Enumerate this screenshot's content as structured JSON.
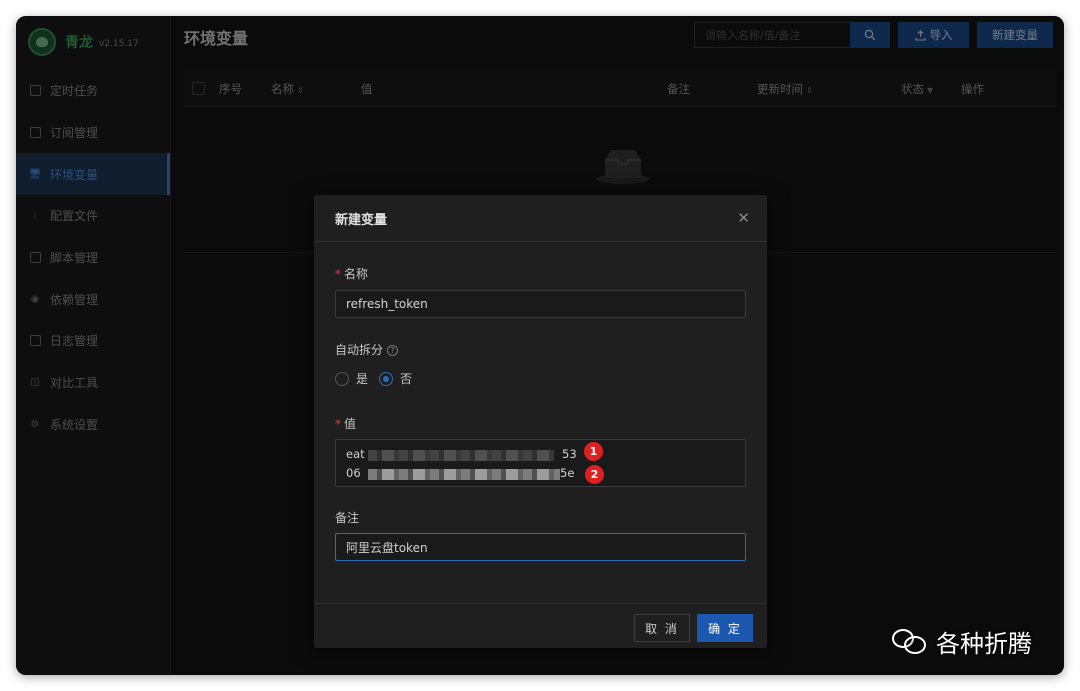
{
  "app": {
    "name": "青龙",
    "version": "v2.15.17"
  },
  "sidebar": {
    "items": [
      {
        "label": "定时任务",
        "icon": "calendar-icon",
        "active": false
      },
      {
        "label": "订阅管理",
        "icon": "subscription-icon",
        "active": false
      },
      {
        "label": "环境变量",
        "icon": "desktop-icon",
        "active": true
      },
      {
        "label": "配置文件",
        "icon": "control-icon",
        "active": false
      },
      {
        "label": "脚本管理",
        "icon": "script-icon",
        "active": false
      },
      {
        "label": "依赖管理",
        "icon": "database-icon",
        "active": false
      },
      {
        "label": "日志管理",
        "icon": "file-search-icon",
        "active": false
      },
      {
        "label": "对比工具",
        "icon": "diff-icon",
        "active": false
      },
      {
        "label": "系统设置",
        "icon": "setting-icon",
        "active": false
      }
    ]
  },
  "header": {
    "title": "环境变量",
    "search_placeholder": "请输入名称/值/备注",
    "import_label": "导入",
    "new_label": "新建变量"
  },
  "table": {
    "columns": [
      "序号",
      "名称",
      "值",
      "备注",
      "更新时间",
      "状态",
      "操作"
    ]
  },
  "modal": {
    "title": "新建变量",
    "name_label": "名称",
    "name_value": "refresh_token",
    "split_label": "自动拆分",
    "split_yes": "是",
    "split_no": "否",
    "split_selected": "否",
    "value_label": "值",
    "value_line1_prefix": "eat",
    "value_line1_suffix": "53",
    "value_line2_prefix": "06",
    "value_line2_suffix": "5e",
    "remark_label": "备注",
    "remark_value": "阿里云盘token",
    "cancel_label": "取 消",
    "ok_label": "确 定",
    "markers": [
      "1",
      "2"
    ]
  },
  "watermark": {
    "text": "各种折腾"
  },
  "colors": {
    "accent": "#1c57b0",
    "required": "#d8423d",
    "marker": "#e02020",
    "logo_green": "#37a35a"
  }
}
